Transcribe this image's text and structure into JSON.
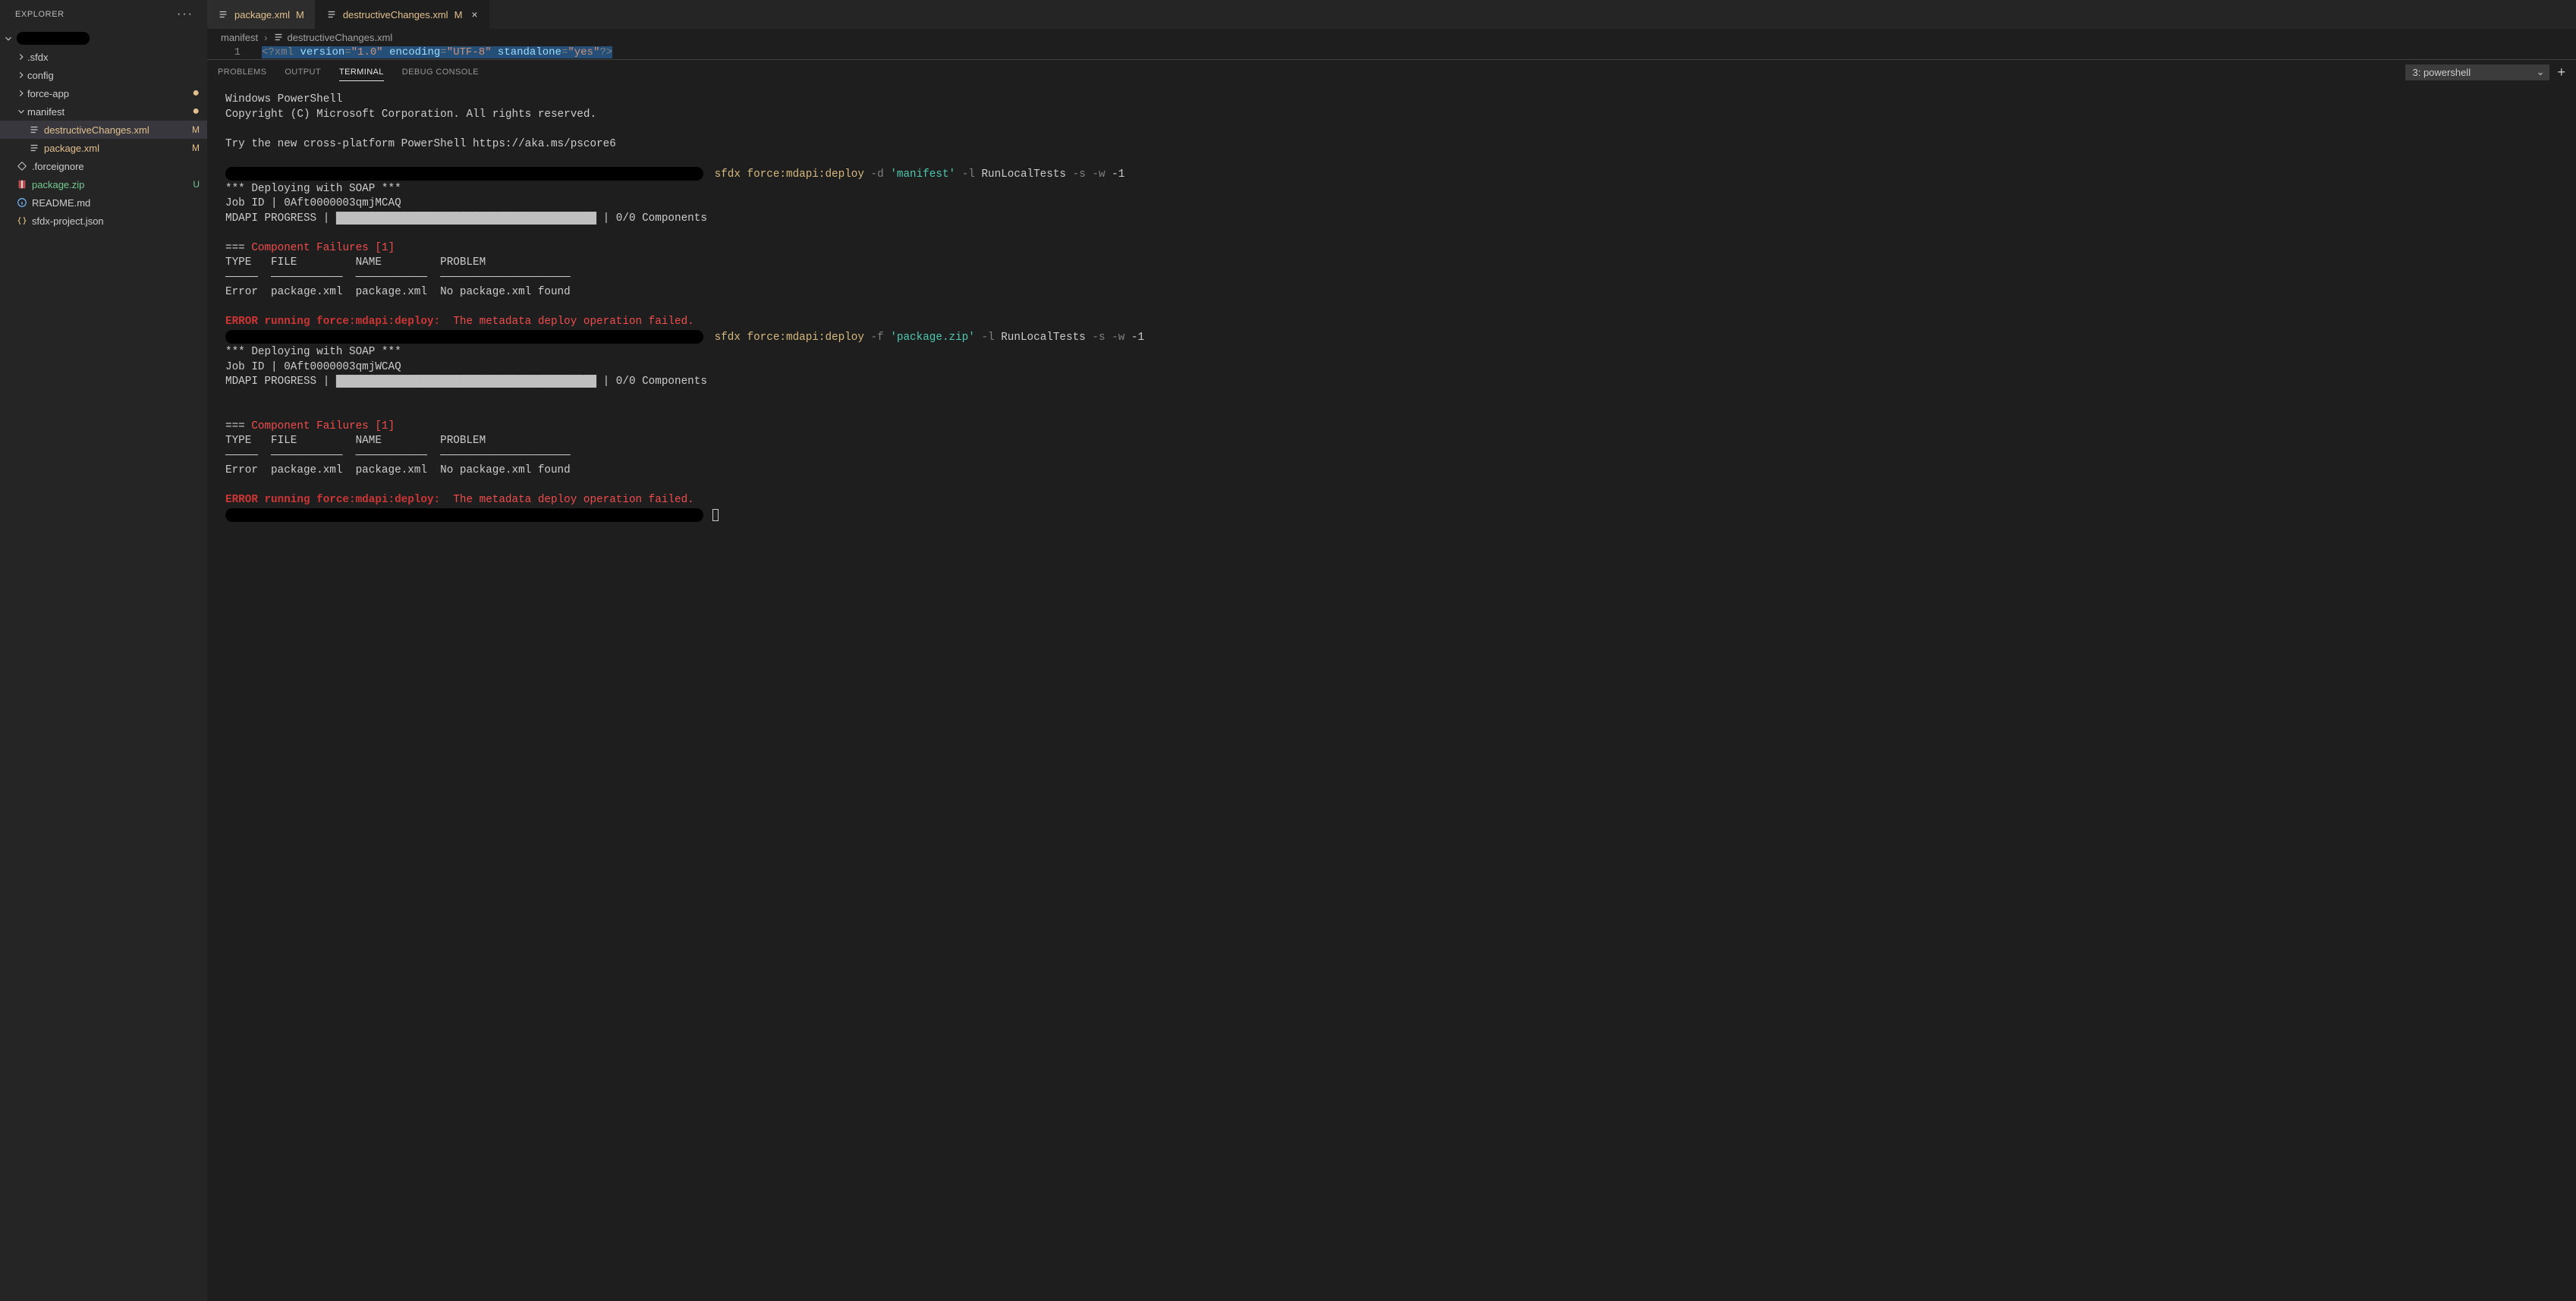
{
  "sidebar": {
    "title": "EXPLORER",
    "items": [
      {
        "type": "folder",
        "label": ".sfdx",
        "depth": 1,
        "expanded": false,
        "git": null,
        "badge": null
      },
      {
        "type": "folder",
        "label": "config",
        "depth": 1,
        "expanded": false,
        "git": null,
        "badge": null
      },
      {
        "type": "folder",
        "label": "force-app",
        "depth": 1,
        "expanded": false,
        "git": "dot",
        "badge": "●"
      },
      {
        "type": "folder",
        "label": "manifest",
        "depth": 1,
        "expanded": true,
        "git": "dot",
        "badge": "●"
      },
      {
        "type": "file",
        "label": "destructiveChanges.xml",
        "depth": 2,
        "git": "mod",
        "badge": "M",
        "active": true,
        "icon": "lines"
      },
      {
        "type": "file",
        "label": "package.xml",
        "depth": 2,
        "git": "mod",
        "badge": "M",
        "icon": "lines"
      },
      {
        "type": "file",
        "label": ".forceignore",
        "depth": 1,
        "git": null,
        "badge": null,
        "icon": "diamond"
      },
      {
        "type": "file",
        "label": "package.zip",
        "depth": 1,
        "git": "untracked",
        "badge": "U",
        "icon": "zip"
      },
      {
        "type": "file",
        "label": "README.md",
        "depth": 1,
        "git": null,
        "badge": null,
        "icon": "info"
      },
      {
        "type": "file",
        "label": "sfdx-project.json",
        "depth": 1,
        "git": null,
        "badge": null,
        "icon": "json"
      }
    ]
  },
  "tabs": [
    {
      "label": "package.xml",
      "git": "M",
      "active": false
    },
    {
      "label": "destructiveChanges.xml",
      "git": "M",
      "active": true
    }
  ],
  "breadcrumbs": [
    {
      "label": "manifest",
      "icon": null
    },
    {
      "label": "destructiveChanges.xml",
      "icon": "lines"
    }
  ],
  "editor": {
    "lineno": "1",
    "pi_open": "<?",
    "pi_name": "xml",
    "attr1": "version",
    "val1": "\"1.0\"",
    "attr2": "encoding",
    "val2": "\"UTF-8\"",
    "attr3": "standalone",
    "val3": "\"yes\"",
    "pi_close": "?>"
  },
  "panel": {
    "tabs": [
      "PROBLEMS",
      "OUTPUT",
      "TERMINAL",
      "DEBUG CONSOLE"
    ],
    "activeTab": 2,
    "selected": "3: powershell"
  },
  "terminal": {
    "l0": "Windows PowerShell",
    "l1": "Copyright (C) Microsoft Corporation. All rights reserved.",
    "l3": "Try the new cross-platform PowerShell https://aka.ms/pscore6",
    "cmd1": {
      "sfdx": "sfdx",
      "sub": "force:mdapi:deploy",
      "f1": "-d",
      "a1": "'manifest'",
      "f2": "-l",
      "a2": "RunLocalTests",
      "f3": "-s",
      "f4": "-w",
      "a4": "-1"
    },
    "d1": "*** Deploying with SOAP ***",
    "d2": "Job ID | 0Aft0000003qmjMCAQ",
    "d3a": "MDAPI PROGRESS | ",
    "d3b": "████████████████████████████████████████",
    "d3c": " | 0/0 Components",
    "f_hdr": "=== ",
    "f_head": "Component Failures [1]",
    "f_cols": "TYPE   FILE         NAME         PROBLEM",
    "f_sep": "─────  ───────────  ───────────  ────────────────────",
    "f_row": "Error  package.xml  package.xml  No package.xml found",
    "err_lead": "ERROR running force:mdapi:deploy:  ",
    "err_msg": "The metadata deploy operation failed.",
    "cmd2": {
      "sfdx": "sfdx",
      "sub": "force:mdapi:deploy",
      "f1": "-f",
      "a1": "'package.zip'",
      "f2": "-l",
      "a2": "RunLocalTests",
      "f3": "-s",
      "f4": "-w",
      "a4": "-1"
    },
    "e2": "Job ID | 0Aft0000003qmjWCAQ"
  }
}
